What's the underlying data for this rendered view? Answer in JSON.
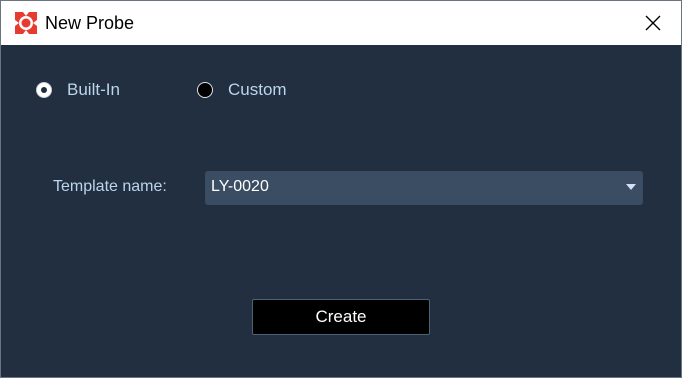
{
  "window": {
    "title": "New Probe",
    "app_icon": "probe-logo-icon",
    "close_icon": "close-icon"
  },
  "probe_type": {
    "options": [
      {
        "label": "Built-In",
        "selected": true
      },
      {
        "label": "Custom",
        "selected": false
      }
    ]
  },
  "template": {
    "label": "Template name:",
    "value": "LY-0020",
    "dropdown_icon": "chevron-down-icon"
  },
  "actions": {
    "create_label": "Create"
  },
  "colors": {
    "background": "#212f40",
    "label_text": "#bcd4ec",
    "select_bg": "#3a4d62",
    "button_bg": "#000000",
    "logo_red": "#e63b2e"
  }
}
